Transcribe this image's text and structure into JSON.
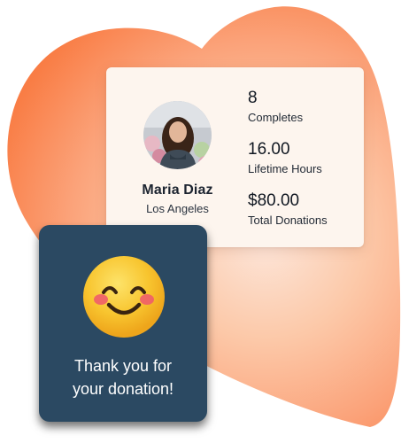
{
  "profile": {
    "name": "Maria Diaz",
    "location": "Los Angeles",
    "avatar_icon": "user-photo"
  },
  "stats": [
    {
      "value": "8",
      "label": "Completes"
    },
    {
      "value": "16.00",
      "label": "Lifetime Hours"
    },
    {
      "value": "$80.00",
      "label": "Total Donations"
    }
  ],
  "thanks": {
    "emoji_icon": "smiling-face-with-blush",
    "line1": "Thank you for",
    "line2": "your donation!"
  },
  "colors": {
    "heart_outer": "#fa8a52",
    "heart_inner": "#fde6da",
    "card_bg": "#fdf5ee",
    "thanks_bg": "#2b4962",
    "emoji_face": "#f8bf2c",
    "emoji_cheek": "#f05d6a"
  }
}
